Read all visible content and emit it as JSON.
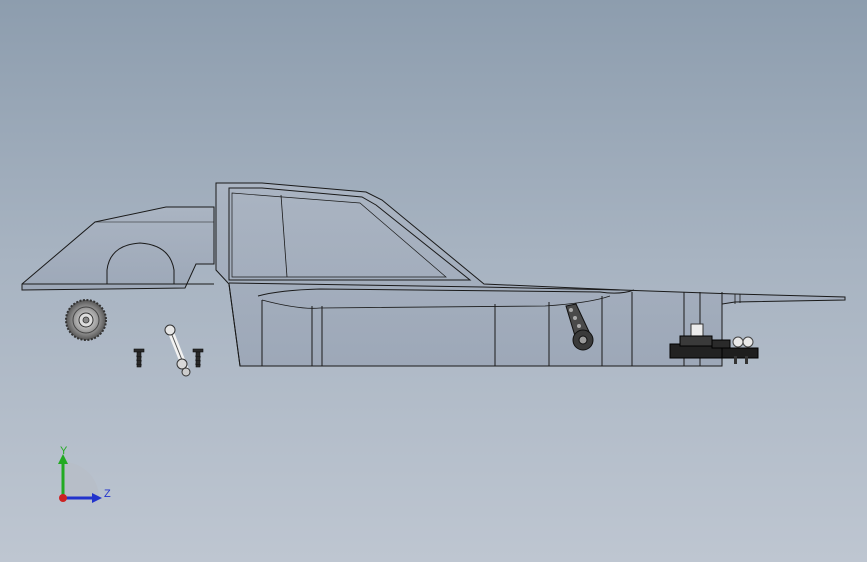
{
  "viewport": {
    "view_orientation": "side",
    "background_top": "#8d9dae",
    "background_bottom": "#bec6d1"
  },
  "model": {
    "edge_color": "#1a1a1a",
    "face_color": "#a3aebd",
    "parts": [
      "car-body-shell",
      "chassis-frame",
      "spur-gear",
      "screw",
      "suspension-link",
      "steering-arm",
      "bumper-mount"
    ]
  },
  "triad": {
    "y_label": "Y",
    "z_label": "Z",
    "y_color": "#22aa22",
    "z_color": "#2233cc",
    "x_color": "#cc2222"
  }
}
